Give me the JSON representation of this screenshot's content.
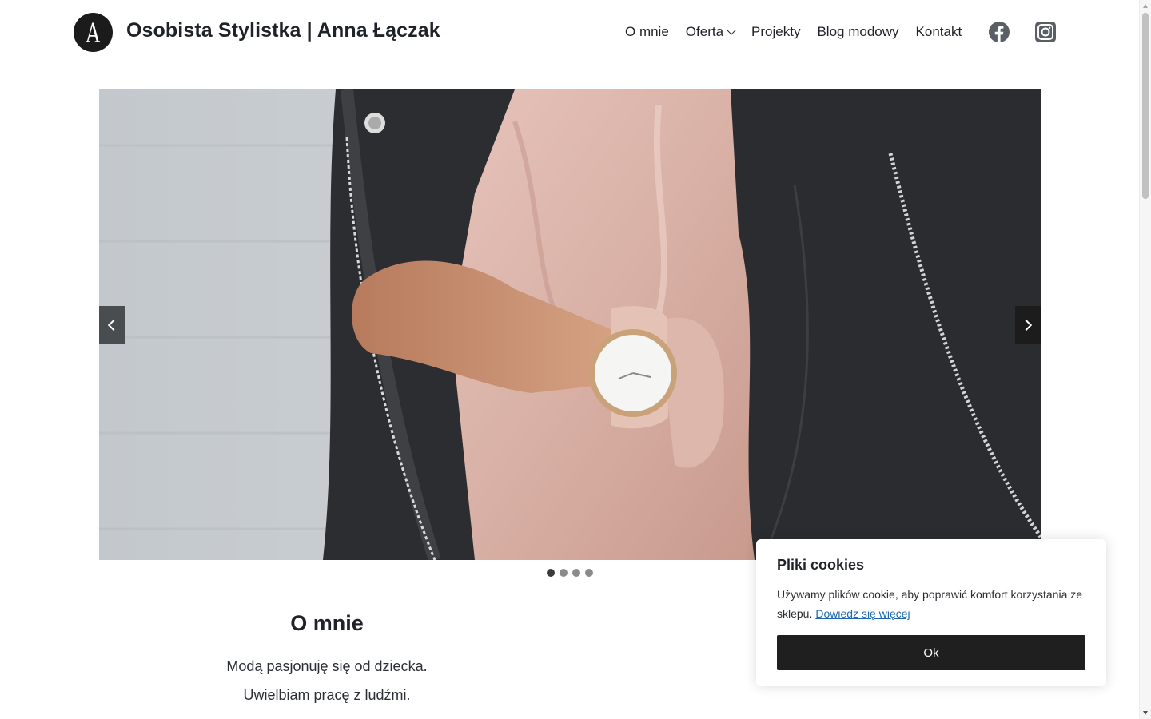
{
  "header": {
    "logo_letter": "A",
    "site_title": "Osobista Stylistka | Anna Łączak",
    "nav": [
      {
        "label": "O mnie"
      },
      {
        "label": "Oferta"
      },
      {
        "label": "Projekty"
      },
      {
        "label": "Blog modowy"
      },
      {
        "label": "Kontakt"
      }
    ],
    "social": [
      "facebook-icon",
      "instagram-icon"
    ]
  },
  "slider": {
    "slide_count": 4,
    "active_slide": 1
  },
  "about": {
    "title": "O mnie",
    "lines": [
      "Modą pasjonuję się od dziecka.",
      "Uwielbiam pracę z ludźmi."
    ]
  },
  "cookie": {
    "title": "Pliki cookies",
    "text": "Używamy plików cookie, aby poprawić komfort korzystania ze sklepu.",
    "link": "Dowiedz się więcej",
    "ok": "Ok"
  },
  "colors": {
    "text": "#1f2228",
    "button_dark": "#1f1f1f",
    "link": "#1d6ab0",
    "icon_gray": "#5a5f66"
  }
}
